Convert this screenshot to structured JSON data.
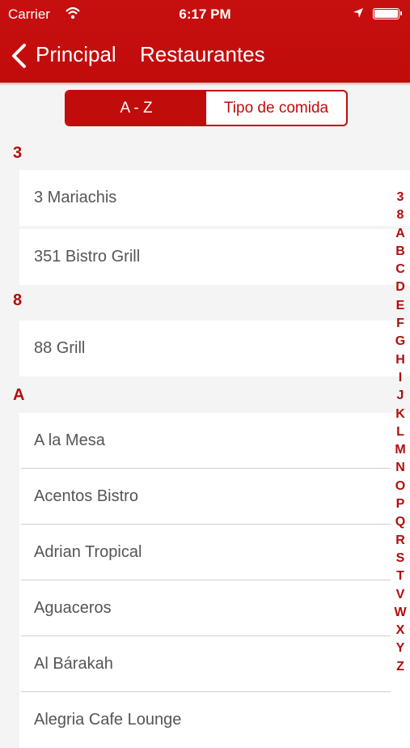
{
  "status_bar": {
    "carrier": "Carrier",
    "time": "6:17 PM"
  },
  "nav": {
    "back_label": "Principal",
    "title": "Restaurantes"
  },
  "segmented": {
    "options": [
      "A - Z",
      "Tipo de comida"
    ],
    "selected": "A - Z"
  },
  "sections": [
    {
      "header": "3",
      "rows": [
        "3 Mariachis",
        "351 Bistro Grill"
      ]
    },
    {
      "header": "8",
      "rows": [
        "88 Grill"
      ]
    },
    {
      "header": "A",
      "rows": [
        "A la Mesa",
        "Acentos Bistro",
        "Adrian Tropical",
        "Aguaceros",
        "Al Bárakah",
        "Alegria Cafe Lounge"
      ]
    }
  ],
  "index_letters": [
    "3",
    "8",
    "A",
    "B",
    "C",
    "D",
    "E",
    "F",
    "G",
    "H",
    "I",
    "J",
    "K",
    "L",
    "M",
    "N",
    "O",
    "P",
    "Q",
    "R",
    "S",
    "T",
    "V",
    "W",
    "X",
    "Y",
    "Z"
  ],
  "colors": {
    "brand_red": "#c10c0c",
    "text_gray": "#555555"
  }
}
